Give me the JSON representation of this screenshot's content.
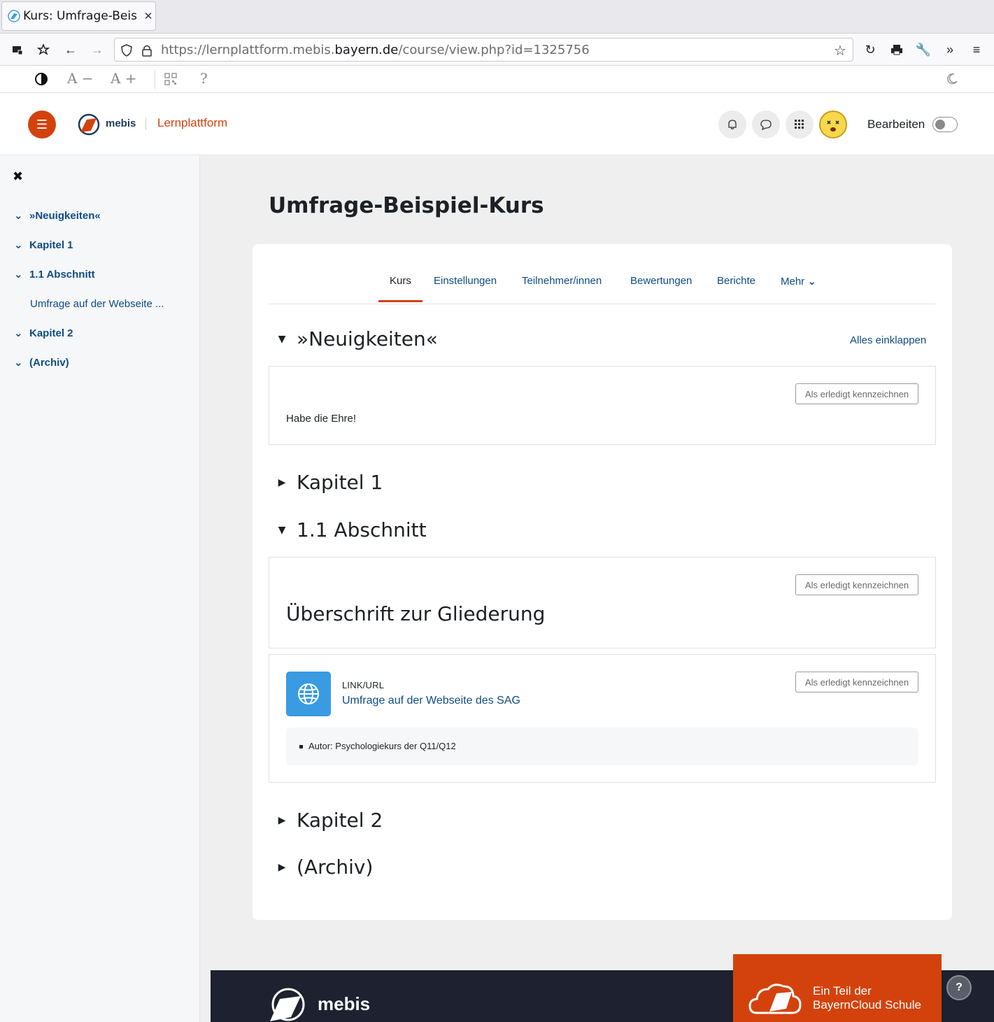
{
  "browser": {
    "tab_title": "Kurs: Umfrage-Beis",
    "url_prefix": "https://lernplattform.mebis.",
    "url_domain": "bayern.de",
    "url_path": "/course/view.php?id=1325756"
  },
  "a11y": {
    "font_smaller": "A −",
    "font_larger": "A +",
    "help": "?"
  },
  "header": {
    "brand": "mebis",
    "subtitle": "Lernplattform",
    "edit_label": "Bearbeiten"
  },
  "drawer": {
    "items": [
      {
        "label": "»Neuigkeiten«"
      },
      {
        "label": "Kapitel 1"
      },
      {
        "label": "1.1 Abschnitt"
      },
      {
        "label": "Umfrage auf der Webseite ..."
      },
      {
        "label": "Kapitel 2"
      },
      {
        "label": "(Archiv)"
      }
    ]
  },
  "course": {
    "title": "Umfrage-Beispiel-Kurs",
    "tabs": [
      "Kurs",
      "Einstellungen",
      "Teilnehmer/innen",
      "Bewertungen",
      "Berichte",
      "Mehr"
    ],
    "collapse_all": "Alles einklappen",
    "done_label": "Als erledigt kennzeichnen",
    "sections": {
      "news": {
        "title": "»Neuigkeiten«",
        "text": "Habe die Ehre!"
      },
      "kapitel1": {
        "title": "Kapitel 1"
      },
      "abschnitt": {
        "title": "1.1 Abschnitt",
        "heading": "Überschrift zur Gliederung",
        "activity": {
          "type": "LINK/URL",
          "name": "Umfrage auf der Webseite des SAG",
          "meta": "Autor: Psychologiekurs der Q11/Q12"
        }
      },
      "kapitel2": {
        "title": "Kapitel 2"
      },
      "archiv": {
        "title": "(Archiv)"
      }
    }
  },
  "footer": {
    "brand": "mebis",
    "bayern_line1": "Ein Teil der",
    "bayern_line2": "BayernCloud Schule",
    "help": "?"
  },
  "colors": {
    "accent": "#d3420c",
    "link": "#0f4c81",
    "activity_icon": "#399be2",
    "footer": "#1d2130"
  }
}
